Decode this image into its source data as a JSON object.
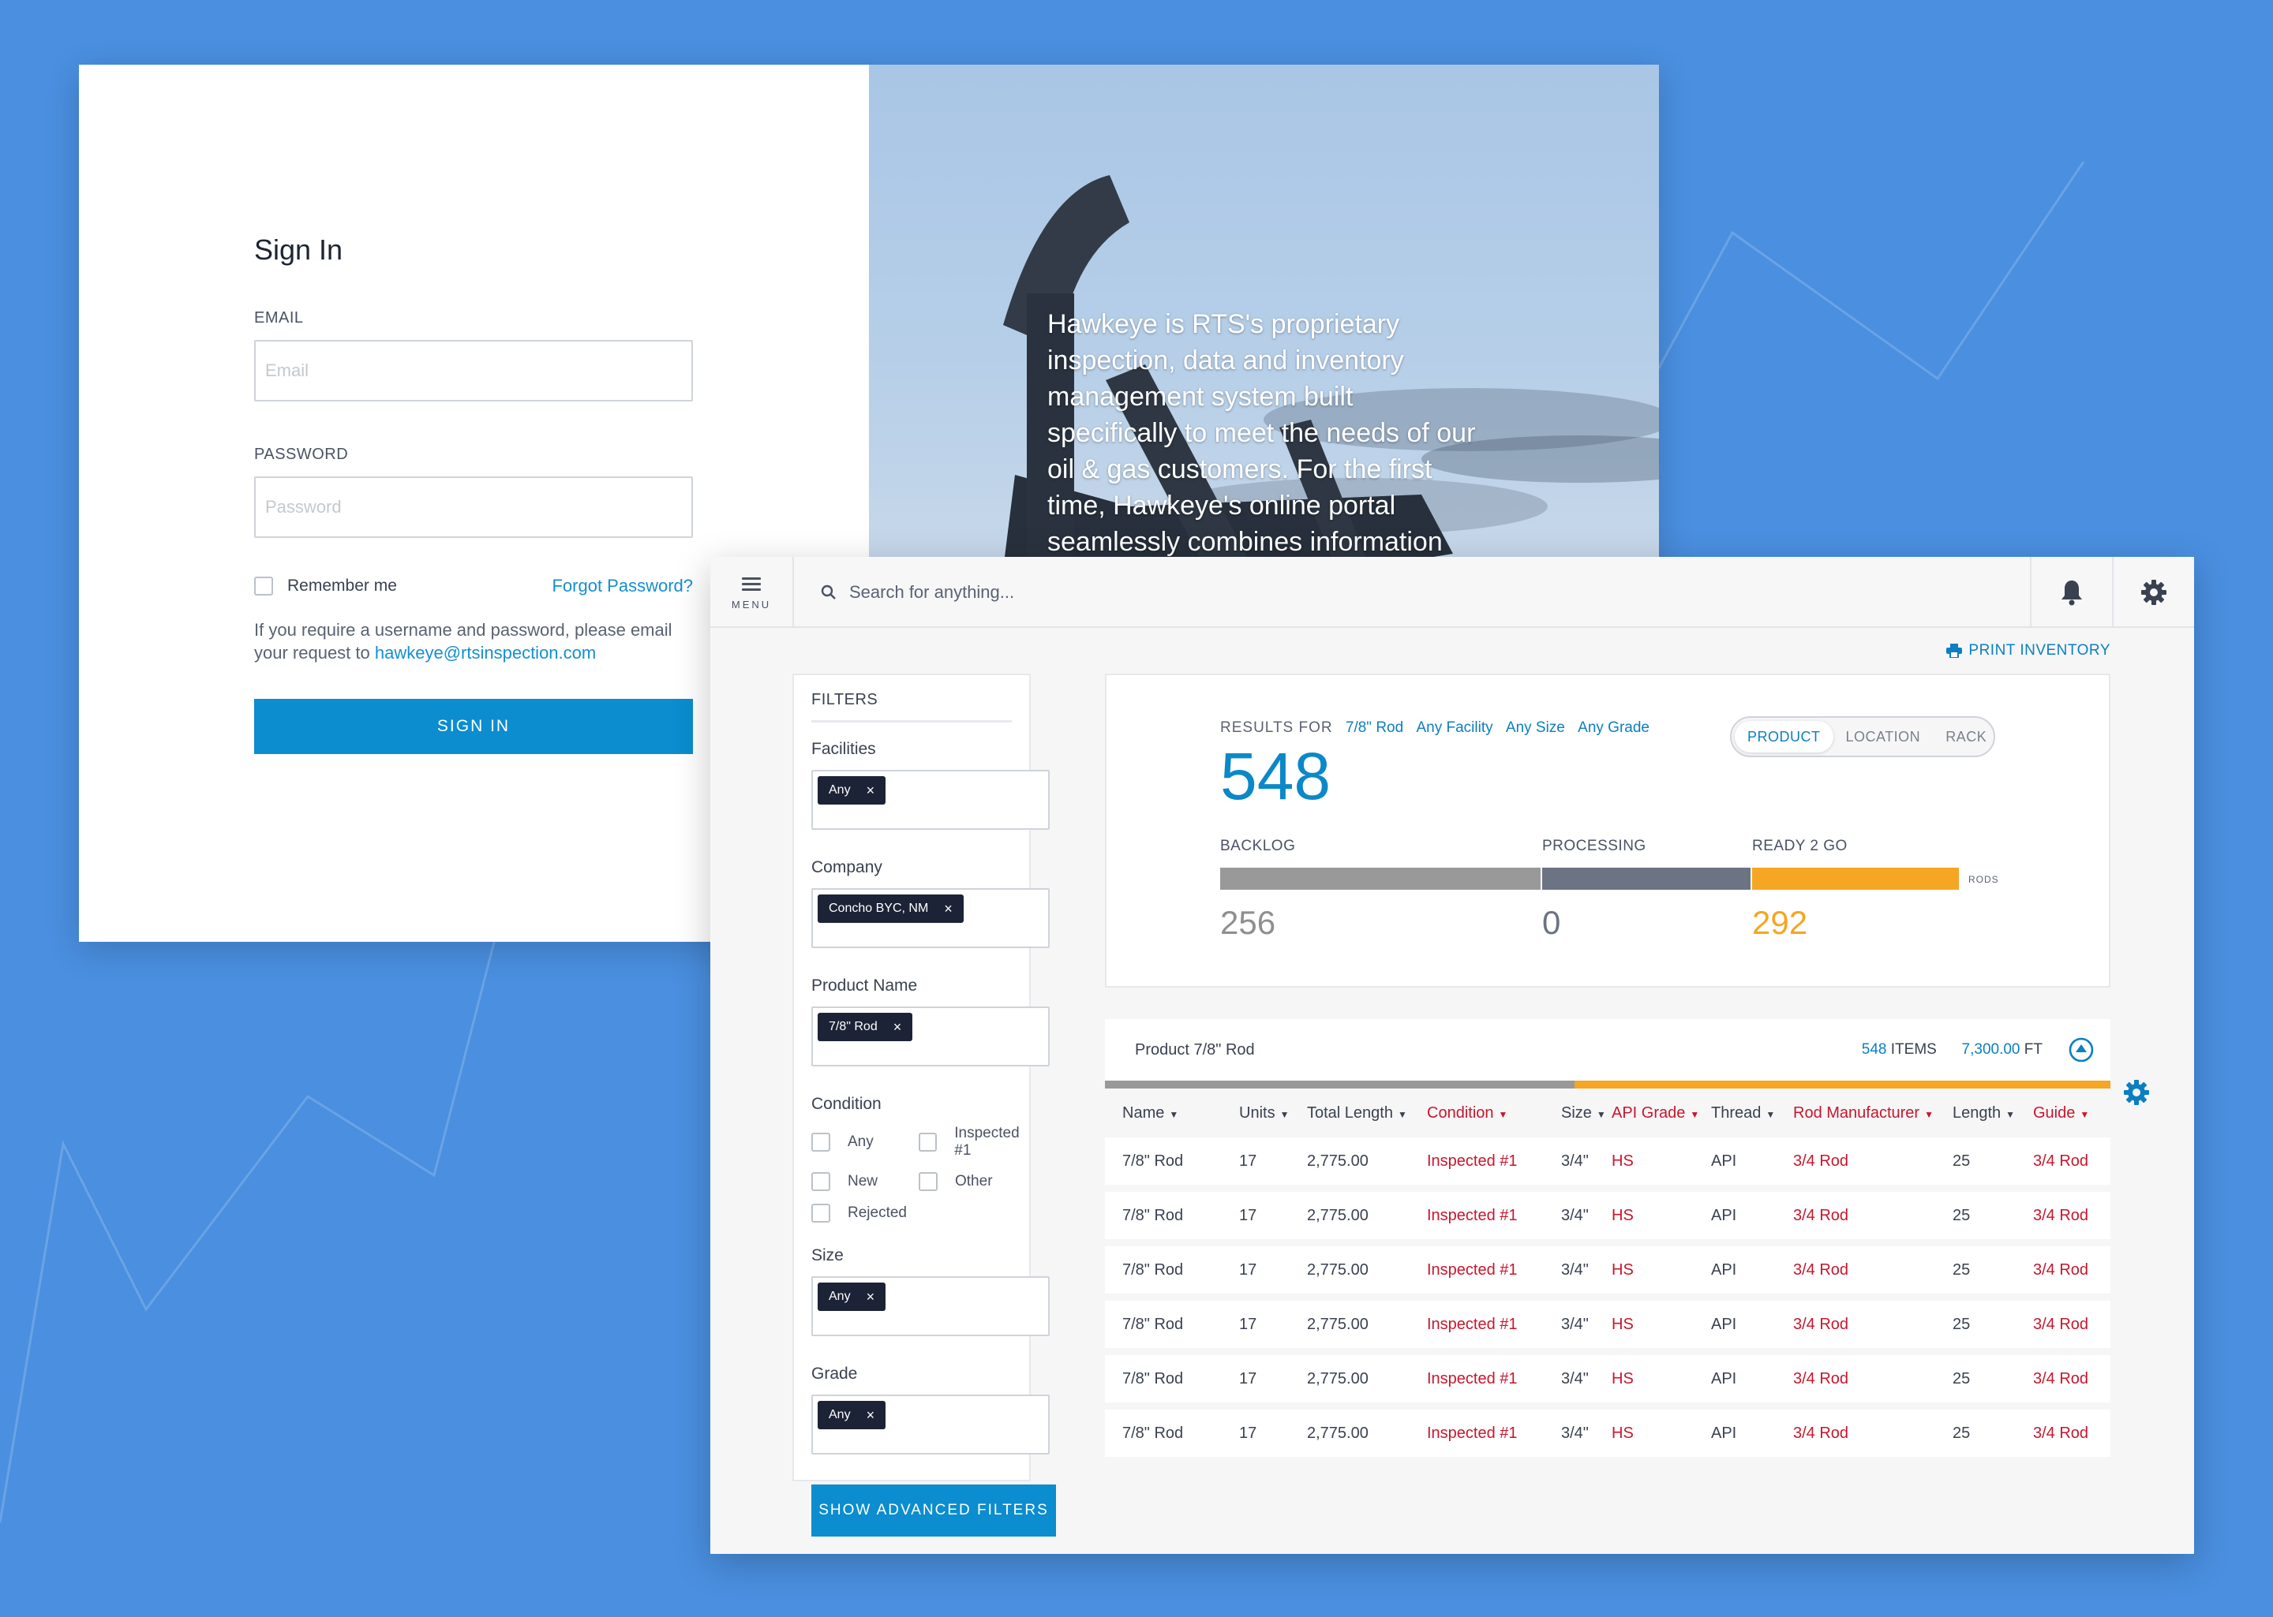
{
  "signin": {
    "title": "Sign In",
    "email_label": "EMAIL",
    "email_placeholder": "Email",
    "password_label": "PASSWORD",
    "password_placeholder": "Password",
    "remember_label": "Remember me",
    "forgot_label": "Forgot Password?",
    "help_text": "If you require a username and password, please email your request to ",
    "help_email": "hawkeye@rtsinspection.com",
    "button_label": "SIGN IN"
  },
  "hero": {
    "text": "Hawkeye is RTS's proprietary inspection, data and inventory management system built specifically to meet the needs of our oil & gas customers. For the first time, Hawkeye's online portal seamlessly combines information"
  },
  "topbar": {
    "menu_label": "MENU",
    "search_placeholder": "Search for anything..."
  },
  "print_label": "PRINT INVENTORY",
  "filters": {
    "title": "FILTERS",
    "facilities_label": "Facilities",
    "facilities_tag": "Any",
    "company_label": "Company",
    "company_tag": "Concho BYC, NM",
    "product_label": "Product Name",
    "product_tag": "7/8\" Rod",
    "condition_label": "Condition",
    "conditions": [
      "Any",
      "Inspected #1",
      "New",
      "Other",
      "Rejected"
    ],
    "size_label": "Size",
    "size_tag": "Any",
    "grade_label": "Grade",
    "grade_tag": "Any",
    "advanced_button": "SHOW ADVANCED FILTERS"
  },
  "results": {
    "results_for_label": "RESULTS FOR",
    "filters": [
      "7/8\" Rod",
      "Any Facility",
      "Any Size",
      "Any Grade"
    ],
    "total": "548",
    "view_options": [
      "PRODUCT",
      "LOCATION",
      "RACK"
    ],
    "active_view": "PRODUCT",
    "backlog_label": "BACKLOG",
    "backlog_value": "256",
    "processing_label": "PROCESSING",
    "processing_value": "0",
    "ready_label": "READY 2 GO",
    "ready_value": "292",
    "unit_label": "RODS",
    "colors": {
      "backlog": "#999999",
      "processing": "#6c7383",
      "ready": "#f5a623",
      "accent": "#0b88c7"
    }
  },
  "table": {
    "title": "Product 7/8\" Rod",
    "items_count": "548",
    "items_label": "ITEMS",
    "length_total": "7,300.00",
    "length_unit": "FT",
    "progress": {
      "backlog_fraction": 0.467,
      "ready_fraction": 0.533
    },
    "columns": [
      "Name",
      "Units",
      "Total Length",
      "Condition",
      "Size",
      "API Grade",
      "Thread",
      "Rod Manufacturer",
      "Length",
      "Guide"
    ],
    "rows": [
      [
        "7/8\" Rod",
        "17",
        "2,775.00",
        "Inspected #1",
        "3/4\"",
        "HS",
        "API",
        "3/4 Rod",
        "25",
        "3/4 Rod"
      ],
      [
        "7/8\" Rod",
        "17",
        "2,775.00",
        "Inspected #1",
        "3/4\"",
        "HS",
        "API",
        "3/4 Rod",
        "25",
        "3/4 Rod"
      ],
      [
        "7/8\" Rod",
        "17",
        "2,775.00",
        "Inspected #1",
        "3/4\"",
        "HS",
        "API",
        "3/4 Rod",
        "25",
        "3/4 Rod"
      ],
      [
        "7/8\" Rod",
        "17",
        "2,775.00",
        "Inspected #1",
        "3/4\"",
        "HS",
        "API",
        "3/4 Rod",
        "25",
        "3/4 Rod"
      ],
      [
        "7/8\" Rod",
        "17",
        "2,775.00",
        "Inspected #1",
        "3/4\"",
        "HS",
        "API",
        "3/4 Rod",
        "25",
        "3/4 Rod"
      ],
      [
        "7/8\" Rod",
        "17",
        "2,775.00",
        "Inspected #1",
        "3/4\"",
        "HS",
        "API",
        "3/4 Rod",
        "25",
        "3/4 Rod"
      ]
    ]
  }
}
